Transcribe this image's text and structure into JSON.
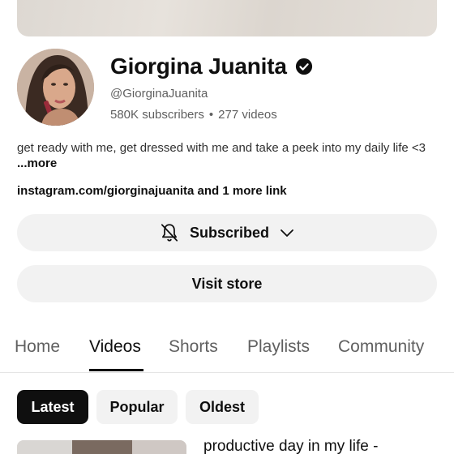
{
  "channel": {
    "name": "Giorgina Juanita",
    "handle": "@GiorginaJuanita",
    "subscribers": "580K subscribers",
    "separator": "•",
    "videos": "277 videos",
    "description": "get ready with me, get dressed with me and take a peek into my daily life <3 ",
    "more_label": "...more",
    "links": "instagram.com/giorginajuanita and 1 more link"
  },
  "buttons": {
    "subscribed": "Subscribed",
    "visit_store": "Visit store"
  },
  "tabs": [
    {
      "label": "Home"
    },
    {
      "label": "Videos",
      "active": true
    },
    {
      "label": "Shorts"
    },
    {
      "label": "Playlists"
    },
    {
      "label": "Community"
    }
  ],
  "chips": [
    {
      "label": "Latest",
      "selected": true
    },
    {
      "label": "Popular"
    },
    {
      "label": "Oldest"
    }
  ],
  "videos": [
    {
      "title": "productive day in my life -"
    }
  ],
  "icons": {
    "verified": "verified-badge-icon",
    "bell": "notifications-off-bell-icon",
    "chevron": "chevron-down-icon"
  },
  "colors": {
    "text_primary": "#0f0f0f",
    "text_secondary": "#606060",
    "button_bg": "#f2f2f2",
    "chip_selected_bg": "#0f0f0f"
  }
}
